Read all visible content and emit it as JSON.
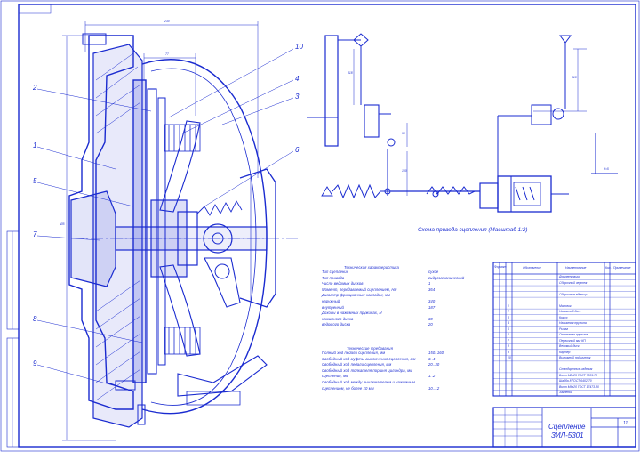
{
  "drawing": {
    "title_line1": "Сцепление",
    "title_line2": "ЗИЛ-5301",
    "sheet_number": "11",
    "scheme_caption": "Схема привода сцепления (Масштаб 1:2)"
  },
  "part_labels": [
    "1",
    "2",
    "3",
    "4",
    "5",
    "6",
    "7",
    "8",
    "9",
    "10"
  ],
  "dimensions": {
    "overall_width": "230",
    "inner_width": "77",
    "diameter": "Ø5",
    "scheme_v1": "318",
    "scheme_v2": "318",
    "scheme_v3": "90",
    "scheme_v4": "100",
    "scheme_v5": "318",
    "scheme_v6": "120",
    "scheme_v7": "Ø1",
    "scheme_v8": "f=5"
  },
  "tech_char": {
    "heading": "Техническая характеристика",
    "rows": [
      {
        "label": "Тип сцепления",
        "value": "сухое"
      },
      {
        "label": "Тип привода",
        "value": "гидромеханический"
      },
      {
        "label": "Число ведомых дисков",
        "value": "1"
      },
      {
        "label": "Момент, передаваемый сцеплением, Нм",
        "value": "364"
      },
      {
        "label": "Диаметр фрикционных накладок, мм",
        "value": ""
      },
      {
        "label": "наружный",
        "value": "340"
      },
      {
        "label": "внутренний",
        "value": "187"
      },
      {
        "label": "Доходы в нажимных пружинах, Н",
        "value": ""
      },
      {
        "label": "нажимного диска",
        "value": "30"
      },
      {
        "label": "ведомого диска",
        "value": "20"
      }
    ]
  },
  "tech_req": {
    "heading": "Технические требования",
    "rows": [
      {
        "label": "Полный ход педали сцепления, мм",
        "value": "150..160"
      },
      {
        "label": "Свободный ход муфты выключения сцепления, мм",
        "value": "3..4"
      },
      {
        "label": "Свободный ход педали сцепления, мм",
        "value": "20..30"
      },
      {
        "label": "Свободный ход толкателя поршня цилиндра, мм",
        "value": ""
      },
      {
        "label": "сцепления, мм",
        "value": "1..2"
      },
      {
        "label": "Свободный ход между выключателем и нажимным",
        "value": ""
      },
      {
        "label": "сцеплением, не более 10 мм",
        "value": "10..12"
      }
    ]
  },
  "spec_table": {
    "headers": [
      "Формат",
      "Зона",
      "Поз.",
      "Обозначение",
      "Наименование",
      "Кол.",
      "Примечание"
    ],
    "rows": [
      {
        "pos": "",
        "name": "Документация"
      },
      {
        "pos": "",
        "name": "Сборочный чертеж"
      },
      {
        "pos": "",
        "name": ""
      },
      {
        "pos": "",
        "name": "Сборочные единицы"
      },
      {
        "pos": "",
        "name": ""
      },
      {
        "pos": "1",
        "name": "Маховик"
      },
      {
        "pos": "2",
        "name": "Нажимной диск"
      },
      {
        "pos": "3",
        "name": "Кожух"
      },
      {
        "pos": "4",
        "name": "Нажимная пружина"
      },
      {
        "pos": "5",
        "name": "Рычаг"
      },
      {
        "pos": "6",
        "name": "Оттяжная пружина"
      },
      {
        "pos": "7",
        "name": "Первичный вал КП"
      },
      {
        "pos": "8",
        "name": "Ведомый диск"
      },
      {
        "pos": "9",
        "name": "Картер"
      },
      {
        "pos": "10",
        "name": "Выжимной подшипник"
      },
      {
        "pos": "",
        "name": ""
      },
      {
        "pos": "",
        "name": "Стандартные изделия"
      },
      {
        "pos": "",
        "name": "Болт М8х25 ГОСТ 7805-70"
      },
      {
        "pos": "",
        "name": "Шайба 8 ГОСТ 6402-70"
      },
      {
        "pos": "",
        "name": "Винт М6х20 ГОСТ 17473-80"
      },
      {
        "pos": "",
        "name": "Заклепка"
      }
    ]
  },
  "colors": {
    "ink": "#1a2bd0",
    "paper": "#ffffff"
  }
}
